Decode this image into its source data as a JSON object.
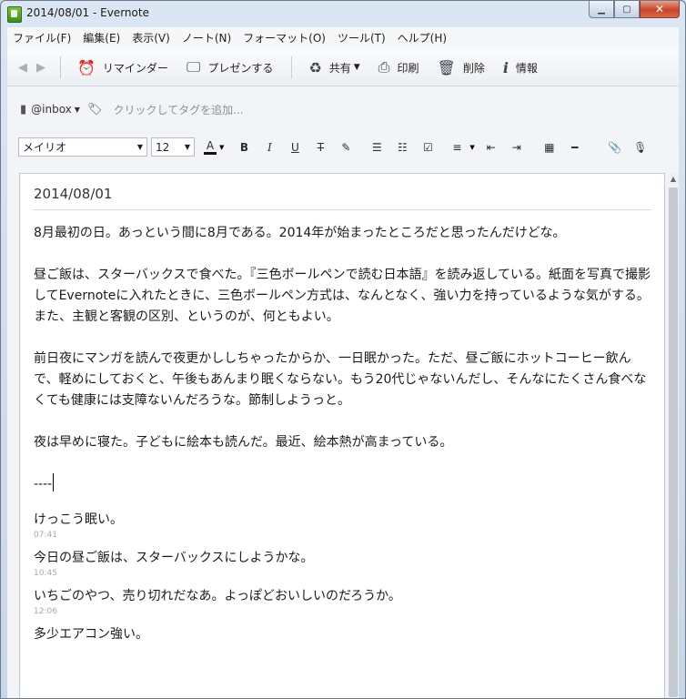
{
  "window": {
    "title": "2014/08/01 - Evernote"
  },
  "menu": [
    "ファイル(F)",
    "編集(E)",
    "表示(V)",
    "ノート(N)",
    "フォーマット(O)",
    "ツール(T)",
    "ヘルプ(H)"
  ],
  "toolbar": {
    "reminder": "リマインダー",
    "present": "プレゼンする",
    "share": "共有",
    "print": "印刷",
    "delete": "削除",
    "info": "情報"
  },
  "tags": {
    "notebook": "@inbox",
    "placeholder": "クリックしてタグを追加..."
  },
  "format": {
    "font": "メイリオ",
    "size": "12"
  },
  "note": {
    "title": "2014/08/01",
    "paragraphs": [
      "8月最初の日。あっという間に8月である。2014年が始まったところだと思ったんだけどな。",
      "昼ご飯は、スターバックスで食べた。『三色ボールペンで読む日本語』を読み返している。紙面を写真で撮影してEvernoteに入れたときに、三色ボールペン方式は、なんとなく、強い力を持っているような気がする。また、主観と客観の区別、というのが、何ともよい。",
      "前日夜にマンガを読んで夜更かししちゃったからか、一日眠かった。ただ、昼ご飯にホットコーヒー飲んで、軽めにしておくと、午後もあんまり眠くならない。もう20代じゃないんだし、そんなにたくさん食べなくても健康には支障ないんだろうな。節制しようっと。",
      "夜は早めに寝た。子どもに絵本も読んだ。最近、絵本熱が高まっている。"
    ],
    "divider": "----",
    "logs": [
      {
        "text": "けっこう眠い。",
        "time": "07:41"
      },
      {
        "text": "今日の昼ご飯は、スターバックスにしようかな。",
        "time": "10:45"
      },
      {
        "text": "いちごのやつ、売り切れだなあ。よっぽどおいしいのだろうか。",
        "time": "12:06"
      },
      {
        "text": "多少エアコン強い。",
        "time": ""
      }
    ]
  }
}
